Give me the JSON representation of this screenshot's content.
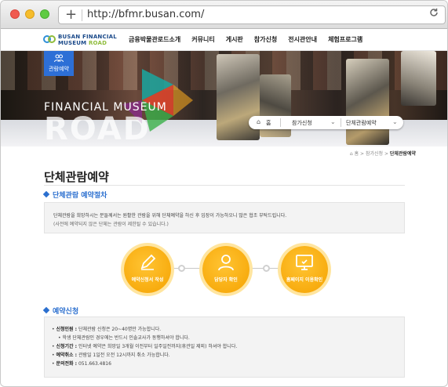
{
  "browser": {
    "url": "http://bfmr.busan.com/",
    "new_tab_icon": "plus-icon",
    "reload_icon": "reload-icon"
  },
  "site": {
    "logo_line1": "BUSAN FINANCIAL",
    "logo_line2a": "MUSEUM",
    "logo_line2b": "ROAD",
    "nav": [
      "금융박물관로드소개",
      "커뮤니티",
      "게시판",
      "참가신청",
      "전시관안내",
      "체험프로그램"
    ]
  },
  "hero": {
    "quick_label": "관람예약",
    "title_small": "FINANCIAL MUSEUM",
    "title_big": "ROAD",
    "crumb_home": "홈",
    "crumb_depth1": "참가신청",
    "crumb_depth2": "단체관람예약"
  },
  "page": {
    "crumb_home": "홈",
    "crumb_mid": "참가신청",
    "crumb_current": "단체관람예약",
    "title": "단체관람예약",
    "section1": "단체관람 예약절차",
    "notice_line1": "단체관람을 희망하시는 분들께서는 원활한 관람을 위해 단체예약을 하신 후 입장이 가능하오니 많은 협조 부탁드립니다.",
    "notice_line2": "(사전에 예약되지 않은 단체는 관람이 제한될 수 있습니다.)",
    "steps": [
      {
        "label": "예약신청서 작성",
        "icon": "pencil-icon"
      },
      {
        "label": "담당자 확인",
        "icon": "person-icon"
      },
      {
        "label": "홈페이지 이용확인",
        "icon": "monitor-icon"
      }
    ],
    "section2": "예약신청",
    "info": [
      {
        "label": "신청인원 :",
        "text": "단체관람 신청은 20~40명만 가능합니다."
      },
      {
        "label": "",
        "text": "학생 단체관람인 경우에는 반드시 인솔교사가 동행하셔야 합니다."
      },
      {
        "label": "신청기간 :",
        "text": "인터넷 예약은 희망일 3개월 이전부터 일주일전까지(휴관일 제외) 하셔야 합니다."
      },
      {
        "label": "예약취소 :",
        "text": "관람일 1일전 오전 12시까지 취소 가능합니다."
      },
      {
        "label": "문의전화 :",
        "text": "051.663.4816"
      }
    ]
  },
  "colors": {
    "accent_blue": "#2b6fcf",
    "step_orange": "#f5a200",
    "logo_navy": "#1b4a8a",
    "logo_green": "#8fbc3b"
  }
}
